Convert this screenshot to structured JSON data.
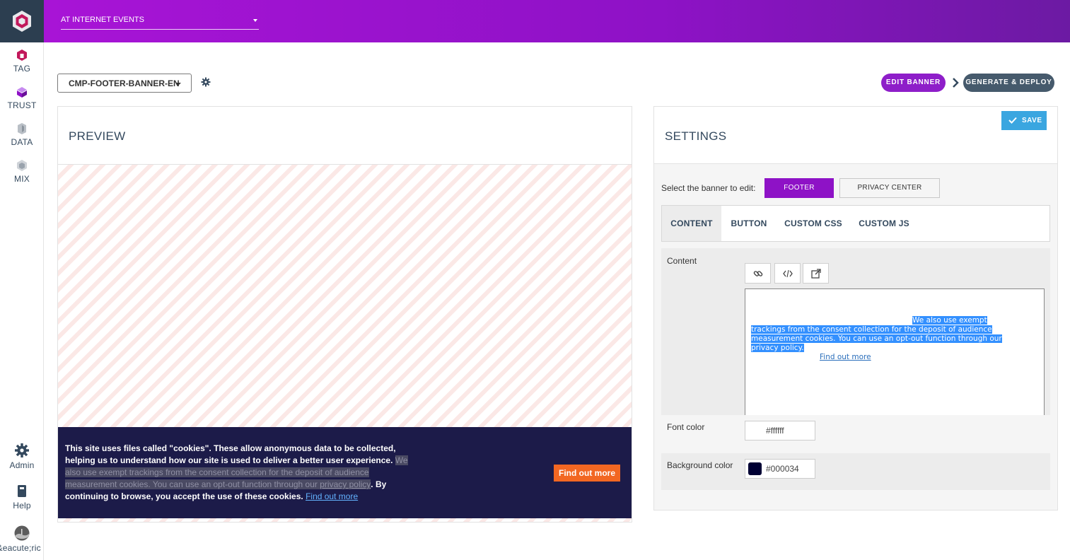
{
  "sidebar": {
    "items": [
      {
        "label": "TAG",
        "icon": "tag-icon"
      },
      {
        "label": "TRUST",
        "icon": "trust-icon"
      },
      {
        "label": "DATA",
        "icon": "data-icon"
      },
      {
        "label": "MIX",
        "icon": "mix-icon"
      }
    ],
    "bottom": [
      {
        "label": "Admin",
        "icon": "gear-icon"
      },
      {
        "label": "Help",
        "icon": "book-icon"
      },
      {
        "label": "G&eacute;ric",
        "icon": "avatar"
      }
    ]
  },
  "header": {
    "site_select": "AT INTERNET EVENTS"
  },
  "toolbar": {
    "banner_select": "CMP-FOOTER-BANNER-EN",
    "steps": [
      "EDIT BANNER",
      "GENERATE & DEPLOY"
    ]
  },
  "preview": {
    "title": "PREVIEW",
    "cookie": {
      "text_before": "This site uses files called \"cookies\". These allow anonymous data to be collected, helping us to understand how our site is used to deliver a better user experience.",
      "highlight_start": "We also use exempt trackings from the consent collection for the deposit of audience measurement cookies. You can use an opt-out function through our",
      "highlight_link": "privacy policy",
      "text_after": ". By continuing to browse, you accept the use of these cookies.",
      "find_more_link": "Find out more",
      "button": "Find out more"
    }
  },
  "settings": {
    "title": "SETTINGS",
    "save": "SAVE",
    "select_label": "Select the banner to edit:",
    "banner_options": [
      "FOOTER",
      "PRIVACY CENTER"
    ],
    "tabs": [
      "CONTENT",
      "BUTTON",
      "CUSTOM CSS",
      "CUSTOM JS"
    ],
    "content_label": "Content",
    "editor_text": "We also use exempt trackings from the consent collection for the deposit of audience measurement cookies. You can use an opt-out function through our privacy policy.",
    "editor_link": "Find out more",
    "font_color_label": "Font color",
    "font_color": "#ffffff",
    "bg_color_label": "Background color",
    "bg_color": "#000034"
  },
  "colors": {
    "brand_purple": "#8e12c6",
    "cookie_bg": "#1c1b49",
    "button_orange": "#f26722",
    "save_blue": "#3aa6e0"
  }
}
